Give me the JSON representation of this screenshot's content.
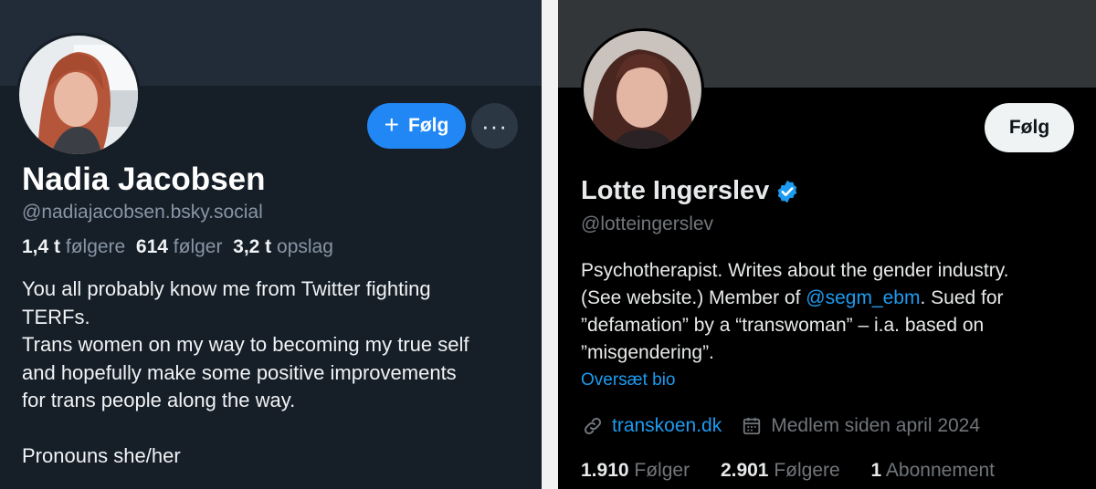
{
  "left_profile": {
    "name": "Nadia Jacobsen",
    "handle": "@nadiajacobsen.bsky.social",
    "follow_button": "Følg",
    "more_button": "···",
    "stats": [
      {
        "value": "1,4 t",
        "label": "følgere"
      },
      {
        "value": "614",
        "label": "følger"
      },
      {
        "value": "3,2 t",
        "label": "opslag"
      }
    ],
    "bio_lines": [
      "You all probably know me from Twitter fighting",
      "TERFs.",
      "Trans women on my way to becoming my true self",
      "and hopefully make some positive improvements",
      "for trans people along the way.",
      "",
      "Pronouns she/her"
    ],
    "colors": {
      "background": "#161e27",
      "accent": "#2087f5"
    }
  },
  "right_profile": {
    "name": "Lotte Ingerslev",
    "handle": "@lotteingerslev",
    "follow_button": "Følg",
    "verified": true,
    "bio": {
      "line1": "Psychotherapist. Writes about the gender industry.",
      "line2_before": "(See website.) Member of ",
      "line2_mention": "@segm_ebm",
      "line2_after": ". Sued for",
      "line3": "”defamation” by a “transwoman” – i.a. based on",
      "line4": "”misgendering”."
    },
    "translate_link": "Oversæt bio",
    "website": "transkoen.dk",
    "joined": "Medlem siden april 2024",
    "stats": [
      {
        "value": "1.910",
        "label": "Følger"
      },
      {
        "value": "2.901",
        "label": "Følgere"
      },
      {
        "value": "1",
        "label": "Abonnement"
      }
    ],
    "colors": {
      "background": "#000000",
      "accent": "#1d9bf0"
    }
  }
}
